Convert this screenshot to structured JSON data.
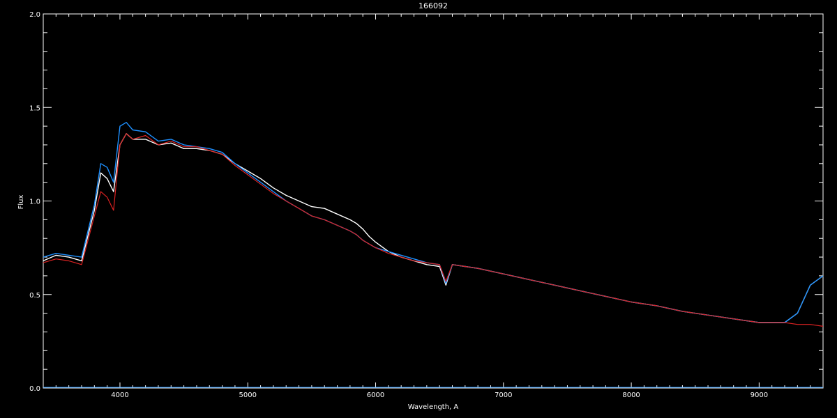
{
  "chart_data": {
    "type": "line",
    "title": "166092",
    "xlabel": "Wavelength, A",
    "ylabel": "Flux",
    "xlim": [
      3400,
      9500
    ],
    "ylim": [
      0.0,
      2.0
    ],
    "x_ticks": [
      4000,
      5000,
      6000,
      7000,
      8000,
      9000
    ],
    "x_tick_labels": [
      "4000",
      "5000",
      "6000",
      "7000",
      "8000",
      "9000"
    ],
    "y_ticks": [
      0.0,
      0.5,
      1.0,
      1.5,
      2.0
    ],
    "y_tick_labels": [
      "0.0",
      "0.5",
      "1.0",
      "1.5",
      "2.0"
    ],
    "grid": false,
    "background": "#000000",
    "series": [
      {
        "color": "#ffffff",
        "x": [
          3400,
          3500,
          3600,
          3700,
          3800,
          3850,
          3900,
          3950,
          4000,
          4050,
          4100,
          4200,
          4300,
          4400,
          4500,
          4600,
          4700,
          4800,
          4900,
          5000,
          5100,
          5200,
          5300,
          5400,
          5500,
          5600,
          5700,
          5800,
          5850,
          5900,
          5950,
          6000,
          6100,
          6200,
          6300,
          6400,
          6500,
          6550,
          6600,
          6700,
          6800,
          7000,
          7200,
          7400,
          7600,
          7800,
          8000,
          8200,
          8400,
          8600,
          8800,
          9000,
          9200,
          9300,
          9400,
          9500
        ],
        "y": [
          0.68,
          0.71,
          0.7,
          0.68,
          0.95,
          1.15,
          1.12,
          1.05,
          1.3,
          1.36,
          1.33,
          1.33,
          1.3,
          1.31,
          1.28,
          1.28,
          1.27,
          1.25,
          1.2,
          1.16,
          1.12,
          1.07,
          1.03,
          1.0,
          0.97,
          0.96,
          0.93,
          0.9,
          0.88,
          0.85,
          0.81,
          0.78,
          0.73,
          0.7,
          0.68,
          0.66,
          0.65,
          0.55,
          0.66,
          0.65,
          0.64,
          0.61,
          0.58,
          0.55,
          0.52,
          0.49,
          0.46,
          0.44,
          0.41,
          0.39,
          0.37,
          0.35,
          0.35,
          0.4,
          0.55,
          0.6
        ]
      },
      {
        "color": "#1e90ff",
        "x": [
          3400,
          3500,
          3600,
          3700,
          3800,
          3850,
          3900,
          3950,
          4000,
          4050,
          4100,
          4200,
          4300,
          4400,
          4500,
          4600,
          4700,
          4800,
          4900,
          5000,
          5100,
          5200,
          5300,
          5400,
          5500,
          5600,
          5700,
          5800,
          5850,
          5900,
          5950,
          6000,
          6100,
          6200,
          6300,
          6400,
          6500,
          6550,
          6600,
          6700,
          6800,
          7000,
          7200,
          7400,
          7600,
          7800,
          8000,
          8200,
          8400,
          8600,
          8800,
          9000,
          9200,
          9300,
          9400,
          9500
        ],
        "y": [
          0.7,
          0.72,
          0.71,
          0.7,
          0.98,
          1.2,
          1.18,
          1.1,
          1.4,
          1.42,
          1.38,
          1.37,
          1.32,
          1.33,
          1.3,
          1.29,
          1.28,
          1.26,
          1.2,
          1.15,
          1.1,
          1.05,
          1.0,
          0.96,
          0.92,
          0.9,
          0.87,
          0.84,
          0.82,
          0.79,
          0.77,
          0.75,
          0.73,
          0.71,
          0.69,
          0.67,
          0.66,
          0.56,
          0.66,
          0.65,
          0.64,
          0.61,
          0.58,
          0.55,
          0.52,
          0.49,
          0.46,
          0.44,
          0.41,
          0.39,
          0.37,
          0.35,
          0.35,
          0.4,
          0.55,
          0.6
        ]
      },
      {
        "color": "#dd2222",
        "x": [
          3400,
          3500,
          3600,
          3700,
          3800,
          3850,
          3900,
          3950,
          4000,
          4050,
          4100,
          4200,
          4300,
          4400,
          4500,
          4600,
          4700,
          4800,
          4900,
          5000,
          5100,
          5200,
          5300,
          5400,
          5500,
          5600,
          5700,
          5800,
          5850,
          5900,
          5950,
          6000,
          6100,
          6200,
          6300,
          6400,
          6500,
          6550,
          6600,
          6700,
          6800,
          7000,
          7200,
          7400,
          7600,
          7800,
          8000,
          8200,
          8400,
          8600,
          8800,
          9000,
          9200,
          9300,
          9400,
          9500
        ],
        "y": [
          0.67,
          0.69,
          0.68,
          0.66,
          0.92,
          1.05,
          1.02,
          0.95,
          1.3,
          1.36,
          1.33,
          1.35,
          1.3,
          1.32,
          1.29,
          1.29,
          1.27,
          1.25,
          1.19,
          1.14,
          1.09,
          1.04,
          1.0,
          0.96,
          0.92,
          0.9,
          0.87,
          0.84,
          0.82,
          0.79,
          0.77,
          0.75,
          0.72,
          0.7,
          0.68,
          0.67,
          0.66,
          0.57,
          0.66,
          0.65,
          0.64,
          0.61,
          0.58,
          0.55,
          0.52,
          0.49,
          0.46,
          0.44,
          0.41,
          0.39,
          0.37,
          0.35,
          0.35,
          0.34,
          0.34,
          0.33
        ]
      }
    ]
  }
}
